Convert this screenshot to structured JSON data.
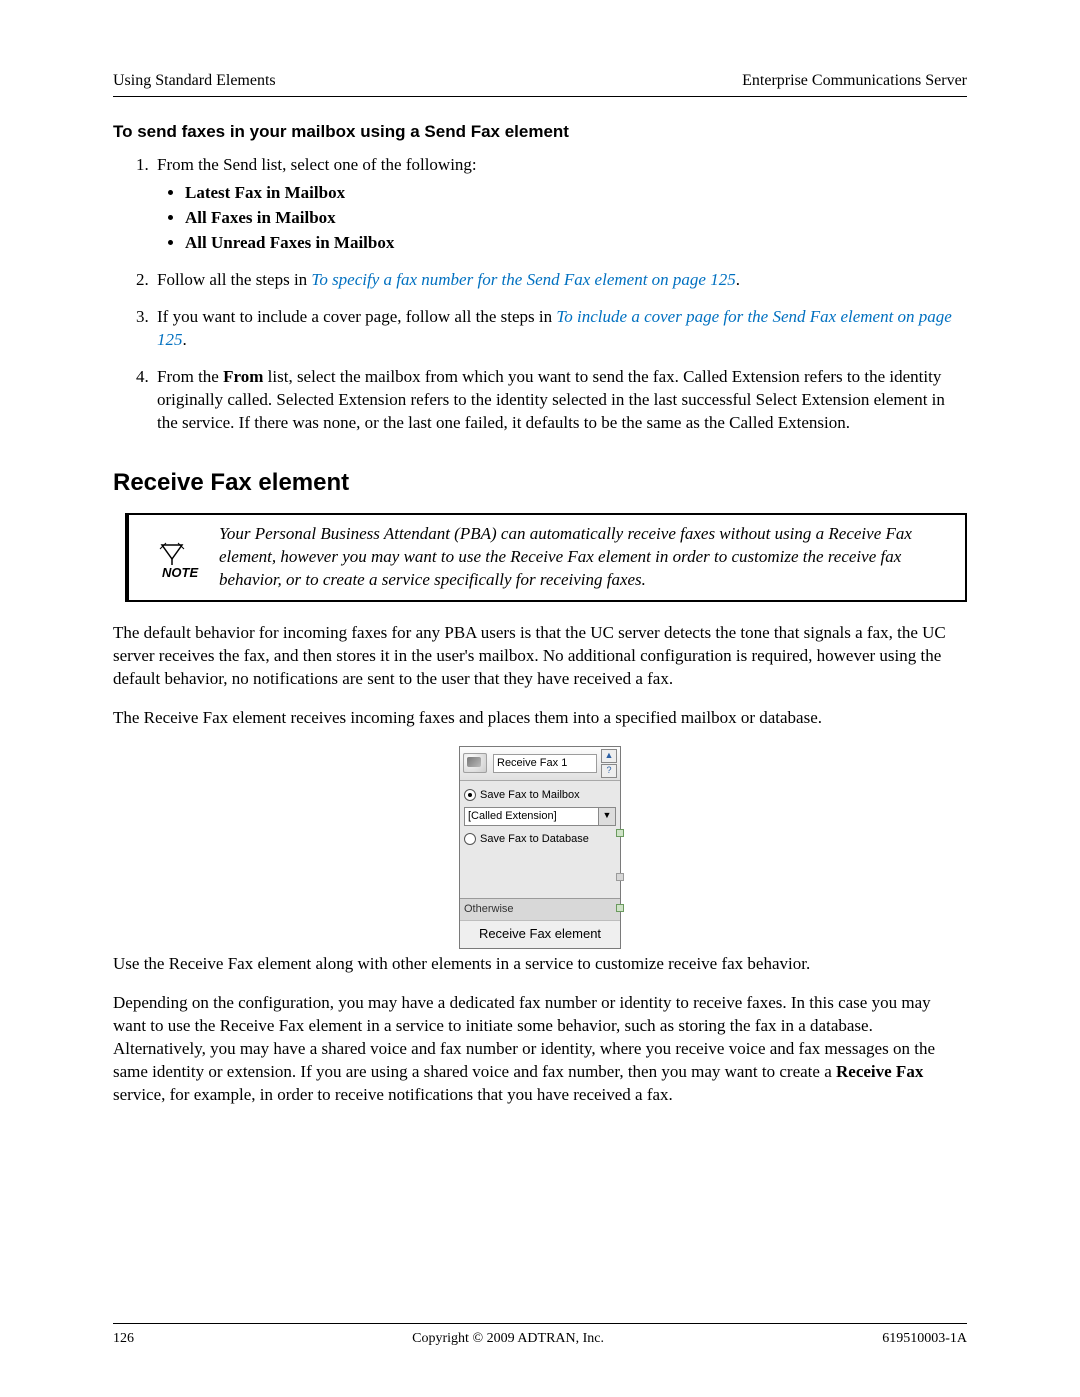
{
  "header": {
    "left": "Using Standard Elements",
    "right": "Enterprise Communications Server"
  },
  "sendFax": {
    "lead": "To send faxes in your mailbox using a Send Fax element",
    "step1_intro": "From the Send list, select one of the following:",
    "bullets": {
      "b1": "Latest Fax in Mailbox",
      "b2": "All Faxes in Mailbox",
      "b3": "All Unread Faxes in Mailbox"
    },
    "step2_prefix": "Follow all the steps in ",
    "step2_link": "To specify a fax number for the Send Fax element on page 125",
    "step2_suffix": ".",
    "step3_prefix": "If you want to include a cover page, follow all the steps in ",
    "step3_link": "To include a cover page for the Send Fax element on page 125",
    "step3_suffix": ".",
    "step4_a": "From the ",
    "step4_bold": "From",
    "step4_b": " list, select the mailbox from which you want to send the fax. Called Extension refers to the identity originally called. Selected Extension refers to the identity selected in the last successful Select Extension element in the service. If there was none, or the last one failed, it defaults to be the same as the Called Extension."
  },
  "receive": {
    "heading": "Receive Fax element",
    "note": "Your Personal Business Attendant (PBA) can automatically receive faxes without using a Receive Fax element, however you may want to use the Receive Fax element in order to customize the receive fax behavior, or to create a service specifically for receiving faxes.",
    "p1": "The default behavior for incoming faxes for any PBA users is that the UC server detects the tone that signals a fax, the UC server receives the fax, and then stores it in the user's mailbox. No additional configuration is required, however using the default behavior, no notifications are sent to the user that they have received a fax.",
    "p2": "The Receive Fax element receives incoming faxes and places them into a specified mailbox or database.",
    "p3": "Use the Receive Fax element along with other elements in a service to customize receive fax behavior.",
    "p4_a": "Depending on the configuration, you may have a dedicated fax number or identity to receive faxes. In this case you may want to use the Receive Fax element in a service to initiate some behavior, such as storing the fax in a database. Alternatively, you may have a shared voice and fax number or identity, where you receive voice and fax messages on the same identity or extension. If you are using a shared voice and fax number, then you may want to create a ",
    "p4_bold": "Receive Fax",
    "p4_b": " service, for example, in order to receive notifications that you have received a fax."
  },
  "faxBox": {
    "title": "Receive Fax 1",
    "help": "?",
    "radio1": "Save Fax to Mailbox",
    "combo": "[Called Extension]",
    "radio2": "Save Fax to Database",
    "otherwise": "Otherwise",
    "caption": "Receive Fax element"
  },
  "footer": {
    "page": "126",
    "center": "Copyright © 2009 ADTRAN, Inc.",
    "right": "619510003-1A"
  }
}
